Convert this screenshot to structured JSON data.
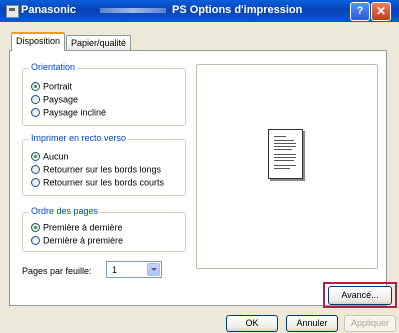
{
  "window": {
    "title_left": "Panasonic",
    "title_right": "PS Options d'impression",
    "help_label": "?",
    "close_label": "✕"
  },
  "tabs": [
    {
      "label": "Disposition",
      "active": true
    },
    {
      "label": "Papier/qualité",
      "active": false
    }
  ],
  "orientation": {
    "legend": "Orientation",
    "options": [
      {
        "label": "Portrait",
        "checked": true
      },
      {
        "label": "Paysage",
        "checked": false
      },
      {
        "label": "Paysage incliné",
        "checked": false
      }
    ]
  },
  "duplex": {
    "legend": "Imprimer en recto verso",
    "options": [
      {
        "label": "Aucun",
        "checked": true
      },
      {
        "label": "Retourner sur les bords longs",
        "checked": false
      },
      {
        "label": "Retourner sur les bords courts",
        "checked": false
      }
    ]
  },
  "page_order": {
    "legend": "Ordre des pages",
    "options": [
      {
        "label": "Première à dernière",
        "checked": true
      },
      {
        "label": "Dernière à première",
        "checked": false
      }
    ]
  },
  "pages_per_sheet": {
    "label": "Pages par feuille:",
    "value": "1"
  },
  "buttons": {
    "advanced": "Avancé...",
    "ok": "OK",
    "cancel": "Annuler",
    "apply": "Appliquer"
  },
  "colors": {
    "titlebar": "#0a50c8",
    "legend_text": "#0046d5",
    "highlight": "#b0204a"
  }
}
